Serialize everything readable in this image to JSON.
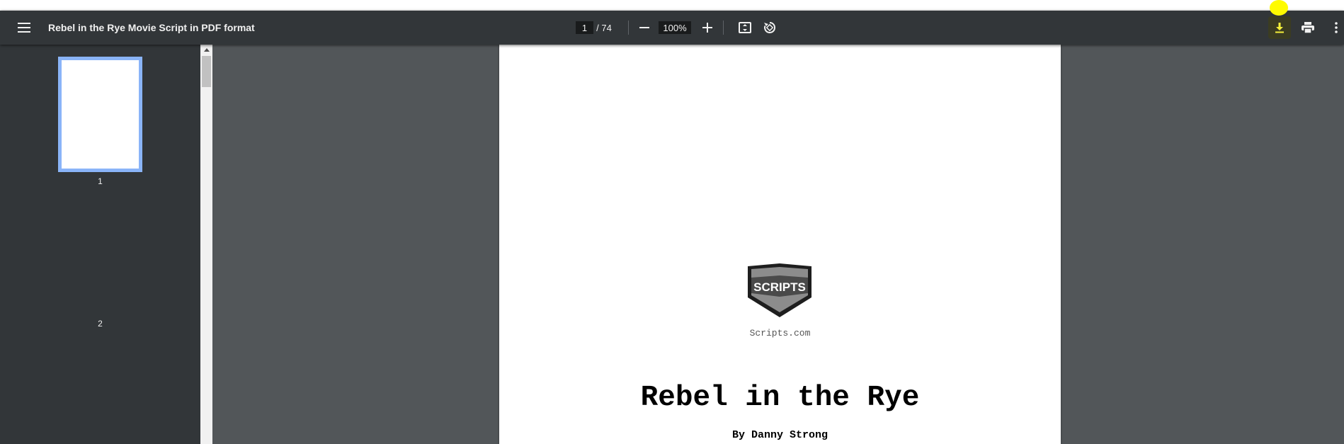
{
  "toolbar": {
    "title": "Rebel in the Rye Movie Script in PDF format",
    "page_current": "1",
    "page_total_text": "/ 74",
    "zoom": "100%",
    "icons": [
      "menu-icon",
      "minus-icon",
      "plus-icon",
      "fit-to-page-icon",
      "rotate-icon",
      "download-icon",
      "print-icon",
      "more-vert-icon"
    ],
    "highlight_color": "#fffb00"
  },
  "sidebar": {
    "thumbnails": [
      {
        "label": "1",
        "selected": true
      },
      {
        "label": "2",
        "selected": false
      }
    ],
    "accent": "#8ab4f8"
  },
  "document": {
    "logo_text": "SCRIPTS",
    "logo_caption": "Scripts.com",
    "title": "Rebel in the Rye",
    "author": "By Danny Strong"
  }
}
